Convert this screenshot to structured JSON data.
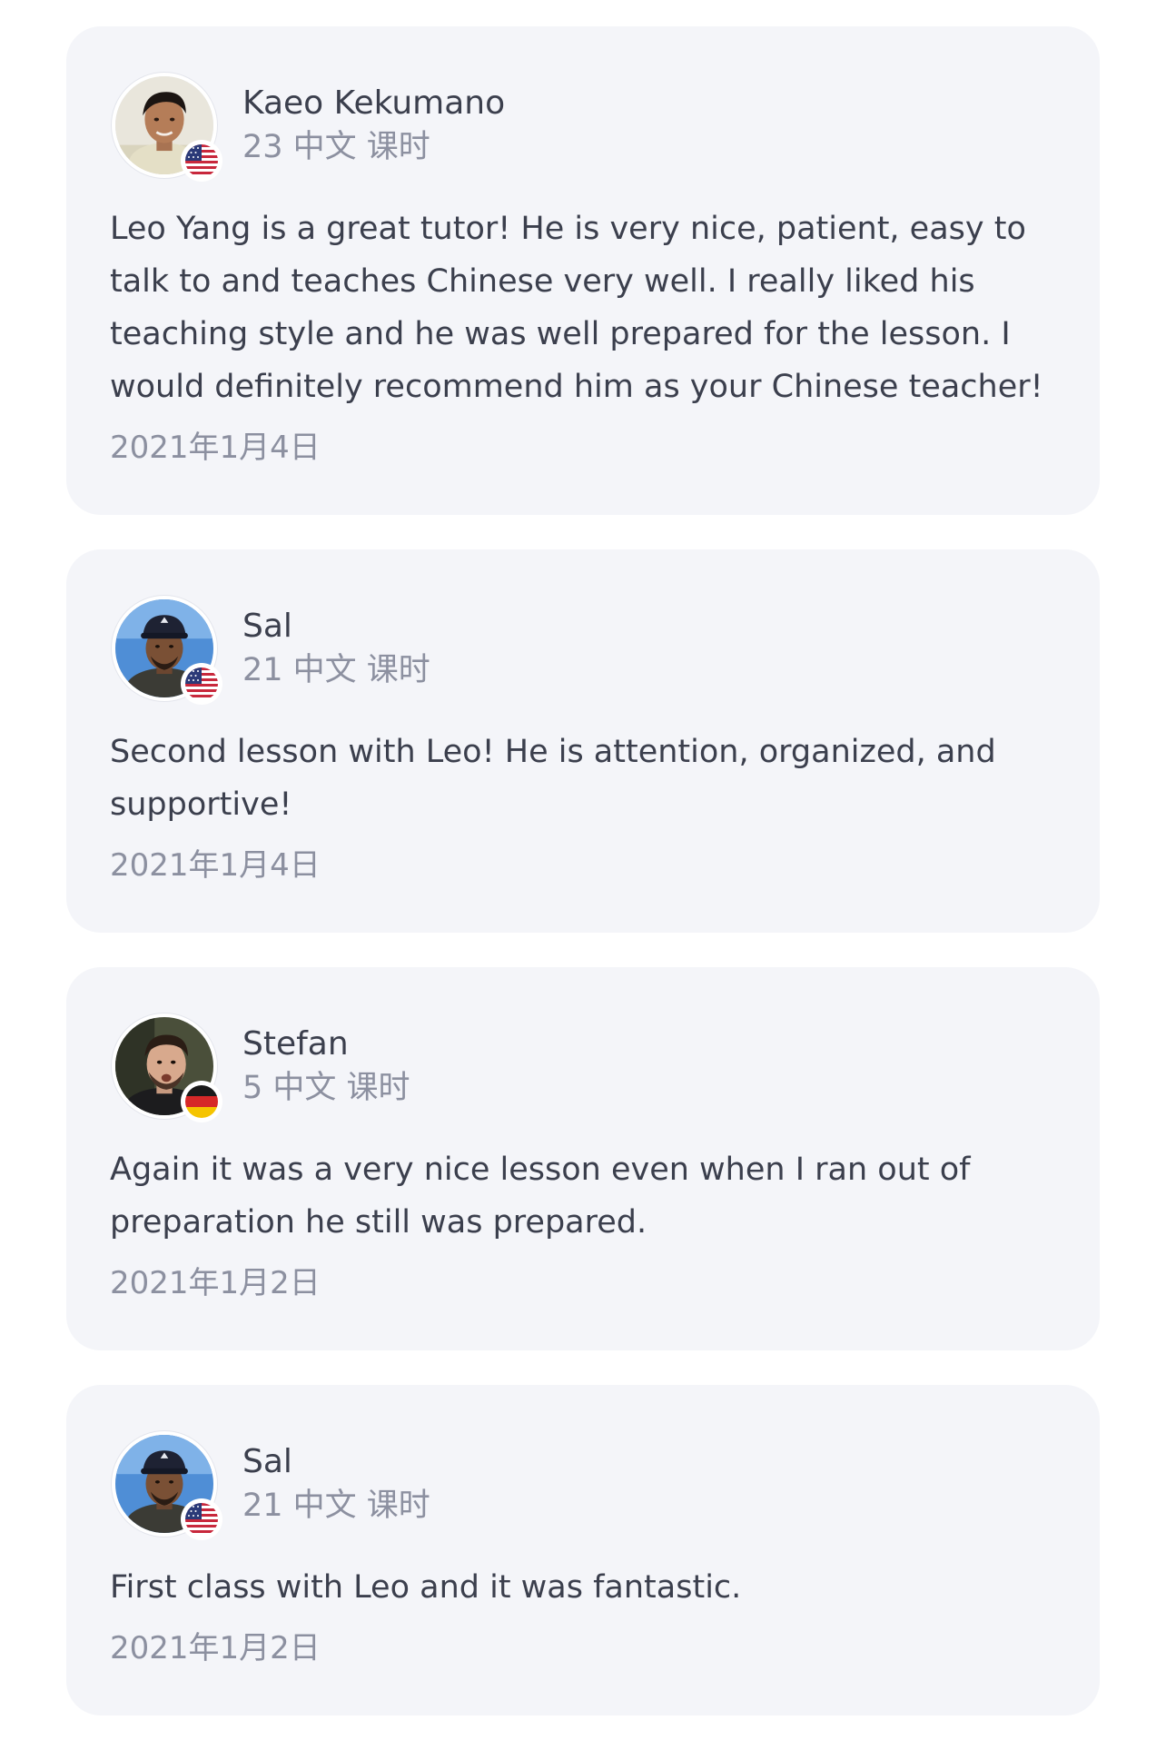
{
  "reviews": [
    {
      "name": "Kaeo Kekumano",
      "lessons": "23 中文 课时",
      "flag_icon": "us-flag-icon",
      "text": "Leo Yang is a great tutor! He is very nice, patient, easy to talk to and teaches Chinese very well. I really liked his teaching style and he was well prepared for the lesson. I would definitely recommend him as your Chinese teacher!",
      "date": "2021年1月4日"
    },
    {
      "name": "Sal",
      "lessons": "21 中文 课时",
      "flag_icon": "us-flag-icon",
      "text": "Second lesson with Leo! He is attention, organized, and supportive!",
      "date": "2021年1月4日"
    },
    {
      "name": "Stefan",
      "lessons": "5 中文 课时",
      "flag_icon": "germany-flag-icon",
      "text": "Again it was a very nice lesson even when I ran out of preparation he still was prepared.",
      "date": "2021年1月2日"
    },
    {
      "name": "Sal",
      "lessons": "21 中文 课时",
      "flag_icon": "us-flag-icon",
      "text": "First class with Leo and it was fantastic.",
      "date": "2021年1月2日"
    }
  ],
  "colors": {
    "card_background": "#f4f5f9",
    "primary_text": "#3b3f4d",
    "secondary_text": "#8c90a0"
  }
}
